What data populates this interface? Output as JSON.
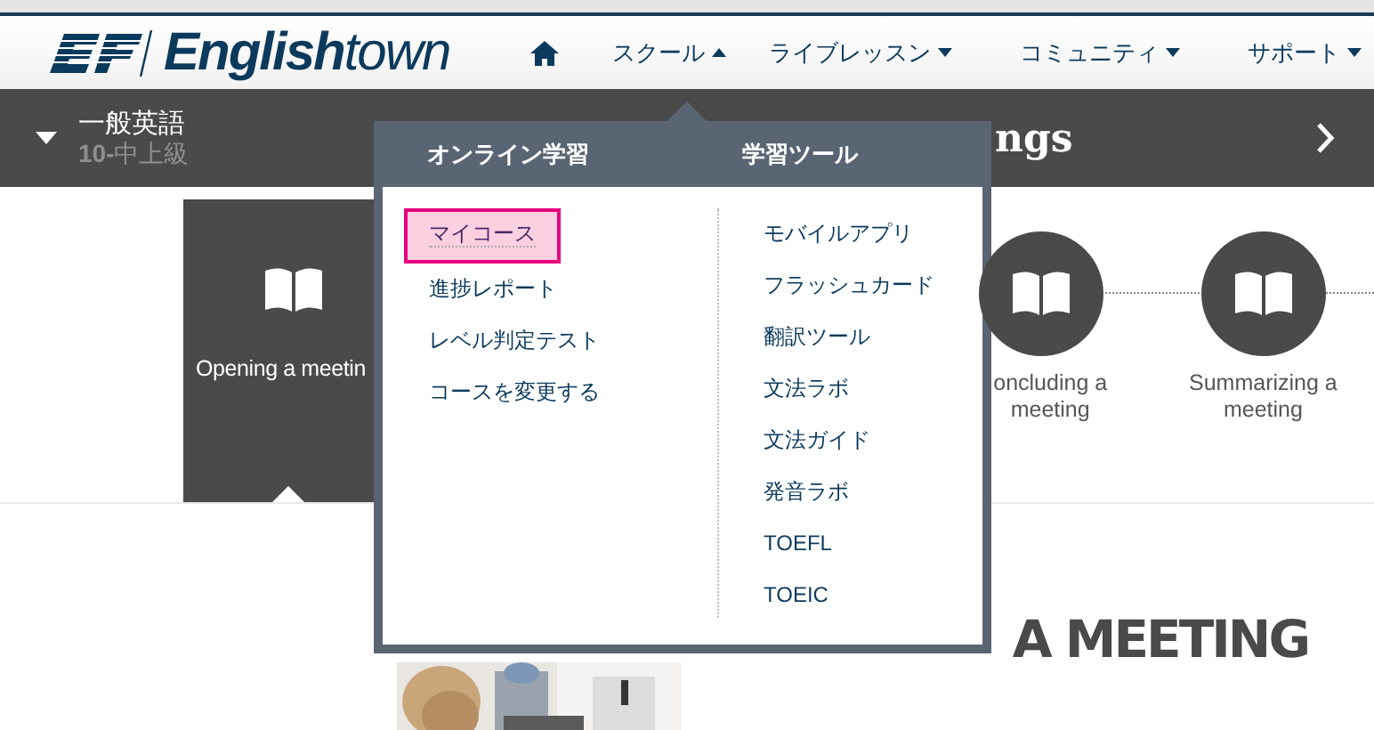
{
  "header": {
    "logo": "**English**town",
    "nav": [
      {
        "kind": "home"
      },
      {
        "kind": "menu",
        "label": "スクール",
        "expanded": true
      },
      {
        "kind": "menu",
        "label": "ライブレッスン",
        "expanded": false
      },
      {
        "kind": "menu",
        "label": "コミュニティ",
        "expanded": false
      },
      {
        "kind": "menu",
        "label": "サポート",
        "expanded": false
      }
    ]
  },
  "course_bar": {
    "course": "一般英語",
    "level_number": "10-",
    "level_name": "中上級",
    "title": "ngs"
  },
  "steps": [
    {
      "title": "Opening a meetin",
      "selected": true
    },
    {
      "title": "oncluding a meeting",
      "selected": false
    },
    {
      "title": "Summarizing a meeting",
      "selected": false
    }
  ],
  "heading": "A MEETING",
  "dropdown": {
    "columns": [
      {
        "title": "オンライン学習",
        "items": [
          {
            "label": "マイコース",
            "selected": true
          },
          {
            "label": "進捗レポート",
            "selected": false
          },
          {
            "label": "レベル判定テスト",
            "selected": false
          },
          {
            "label": "コースを変更する",
            "selected": false
          }
        ]
      },
      {
        "title": "学習ツール",
        "items": [
          {
            "label": "モバイルアプリ",
            "selected": false
          },
          {
            "label": "フラッシュカード",
            "selected": false
          },
          {
            "label": "翻訳ツール",
            "selected": false
          },
          {
            "label": "文法ラボ",
            "selected": false
          },
          {
            "label": "文法ガイド",
            "selected": false
          },
          {
            "label": "発音ラボ",
            "selected": false
          },
          {
            "label": "TOEFL",
            "selected": false
          },
          {
            "label": "TOEIC",
            "selected": false
          }
        ]
      }
    ]
  }
}
